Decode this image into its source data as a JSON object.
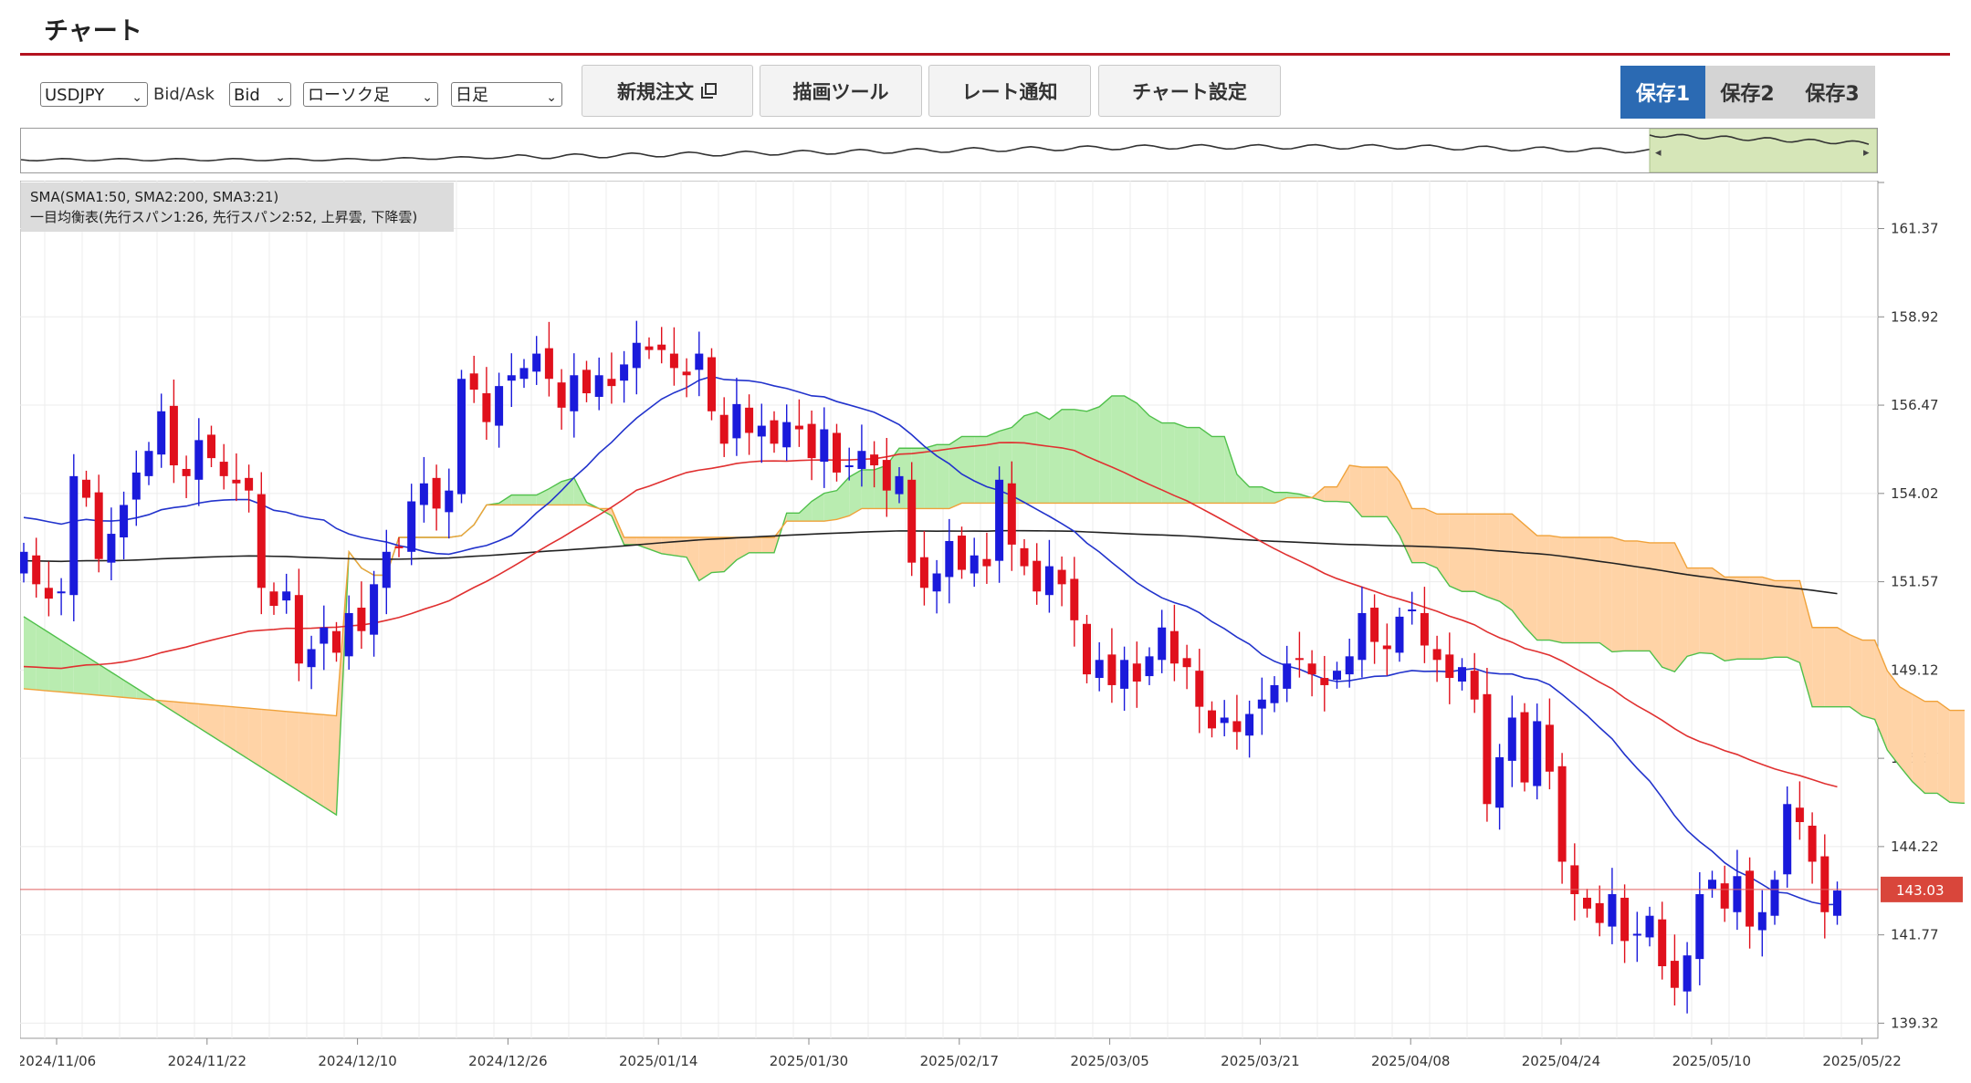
{
  "page": {
    "title": "チャート"
  },
  "toolbar": {
    "symbol": "USDJPY",
    "bidask_label": "Bid/Ask",
    "bidask_value": "Bid",
    "chart_type": "ローソク足",
    "timeframe": "日足",
    "new_order_label": "新規注文",
    "drawing_tools_label": "描画ツール",
    "rate_alert_label": "レート通知",
    "chart_settings_label": "チャート設定",
    "save_slots": [
      "保存1",
      "保存2",
      "保存3"
    ],
    "active_save": 0
  },
  "indicators": {
    "sma": "SMA(SMA1:50, SMA2:200, SMA3:21)",
    "ichimoku": "一目均衡表(先行スパン1:26, 先行スパン2:52, 上昇雲, 下降雲)"
  },
  "chart_data": {
    "type": "candlestick",
    "symbol": "USDJPY",
    "y_ticks": [
      "161.37",
      "158.92",
      "156.47",
      "154.02",
      "151.57",
      "149.12",
      "146.67",
      "144.22",
      "141.77",
      "139.32"
    ],
    "x_ticks": [
      "2024/11/06",
      "2024/11/22",
      "2024/12/10",
      "2024/12/26",
      "2025/01/14",
      "2025/01/30",
      "2025/02/17",
      "2025/03/05",
      "2025/03/21",
      "2025/04/08",
      "2025/04/24",
      "2025/05/10",
      "2025/05/22"
    ],
    "current_price": "143.03",
    "colors": {
      "up": "#1a1adb",
      "down": "#e0101c",
      "sma21": "#2233cc",
      "sma50": "#e03030",
      "sma200": "#222222",
      "cloud_bull": "#b9ecb0",
      "cloud_bear": "#ffd3a6"
    },
    "close": [
      152.4,
      151.5,
      151.1,
      151.3,
      154.5,
      153.9,
      152.2,
      152.9,
      153.7,
      154.6,
      155.2,
      156.3,
      154.8,
      154.5,
      155.5,
      155.0,
      154.5,
      154.3,
      154.1,
      151.4,
      150.9,
      151.3,
      149.3,
      149.7,
      150.3,
      149.6,
      150.7,
      150.2,
      151.5,
      152.4,
      152.5,
      153.8,
      154.3,
      153.6,
      154.1,
      157.2,
      156.9,
      156.0,
      157.0,
      157.3,
      157.5,
      157.9,
      157.2,
      156.4,
      157.3,
      156.8,
      157.3,
      157.0,
      157.6,
      158.2,
      158.0,
      158.0,
      157.5,
      157.3,
      157.9,
      156.3,
      155.4,
      156.5,
      155.7,
      155.9,
      155.4,
      156.0,
      155.8,
      155.0,
      155.8,
      154.6,
      154.8,
      155.2,
      154.8,
      154.1,
      154.5,
      152.1,
      151.4,
      151.8,
      152.7,
      151.9,
      152.3,
      152.0,
      154.4,
      152.6,
      152.0,
      151.3,
      152.0,
      151.5,
      150.5,
      149.0,
      149.4,
      148.7,
      149.4,
      148.8,
      149.5,
      150.3,
      149.3,
      149.2,
      148.1,
      147.5,
      147.8,
      147.4,
      147.9,
      148.3,
      148.7,
      149.3,
      149.4,
      149.0,
      148.7,
      149.1,
      149.5,
      150.7,
      149.9,
      149.7,
      150.6,
      150.8,
      149.8,
      149.4,
      148.9,
      149.2,
      148.3,
      145.4,
      146.7,
      147.8,
      146.0,
      147.7,
      146.3,
      143.8,
      142.9,
      142.5,
      142.1,
      142.9,
      141.6,
      141.8,
      142.3,
      140.9,
      140.3,
      141.2,
      142.9,
      143.3,
      142.5,
      143.4,
      142.0,
      142.4,
      143.3,
      145.4,
      144.9,
      143.8,
      142.4,
      143.0
    ]
  }
}
